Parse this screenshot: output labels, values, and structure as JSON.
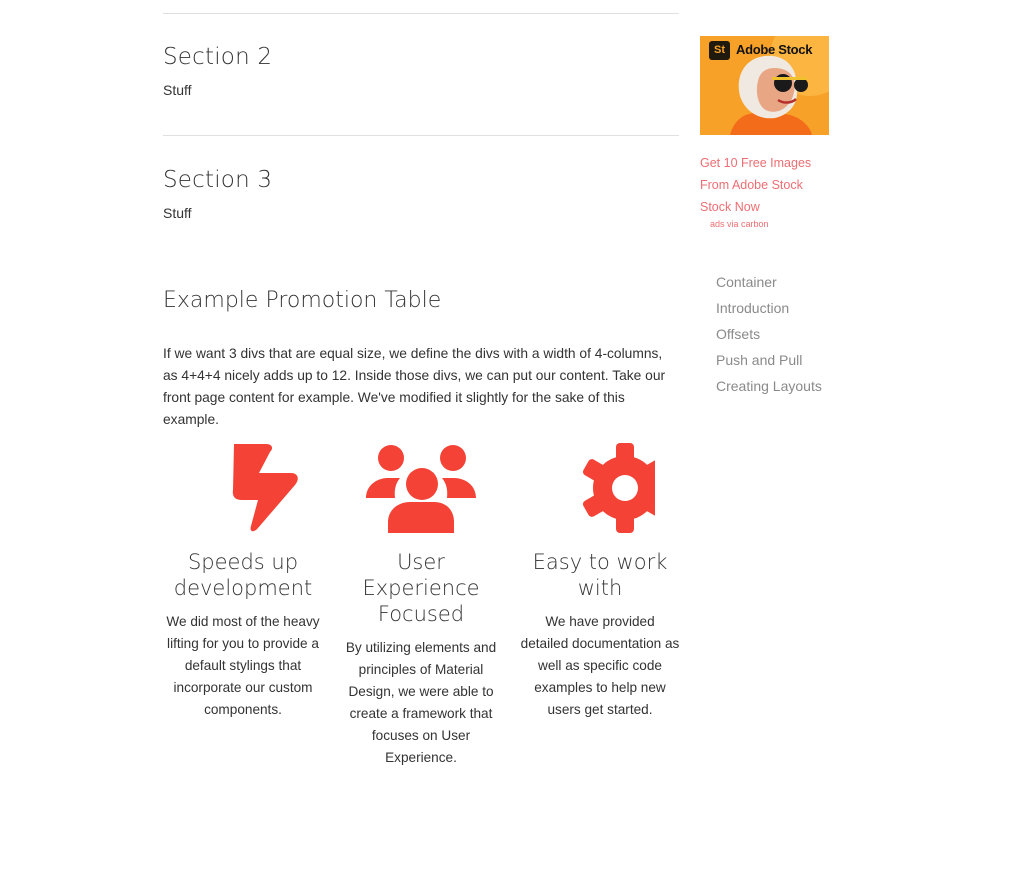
{
  "sections": [
    {
      "title": "Section 2",
      "body": "Stuff"
    },
    {
      "title": "Section 3",
      "body": "Stuff"
    }
  ],
  "promo": {
    "title": "Example Promotion Table",
    "paragraph": "If we want 3 divs that are equal size, we define the divs with a width of 4-columns, as 4+4+4 nicely adds up to 12. Inside those divs, we can put our content. Take our front page content for example. We've modified it slightly for the sake of this example.",
    "columns": [
      {
        "icon": "flash-icon",
        "heading": "Speeds up development",
        "text": "We did most of the heavy lifting for you to provide a default stylings that incorporate our custom components."
      },
      {
        "icon": "group-icon",
        "heading": "User Experience Focused",
        "text": "By utilizing elements and principles of Material Design, we were able to create a framework that focuses on User Experience."
      },
      {
        "icon": "settings-icon",
        "heading": "Easy to work with",
        "text": "We have provided detailed documentation as well as specific code examples to help new users get started."
      }
    ]
  },
  "ad": {
    "brand": "Adobe Stock",
    "logo_letters": "St",
    "link_text": "Get 10 Free Images From Adobe Stock Stock Now",
    "via": "ads via carbon"
  },
  "toc": [
    "Container",
    "Introduction",
    "Offsets",
    "Push and Pull",
    "Creating Layouts"
  ],
  "colors": {
    "accent": "#f44336",
    "link": "#ee6e73",
    "ad_bg": "#f7a128"
  }
}
